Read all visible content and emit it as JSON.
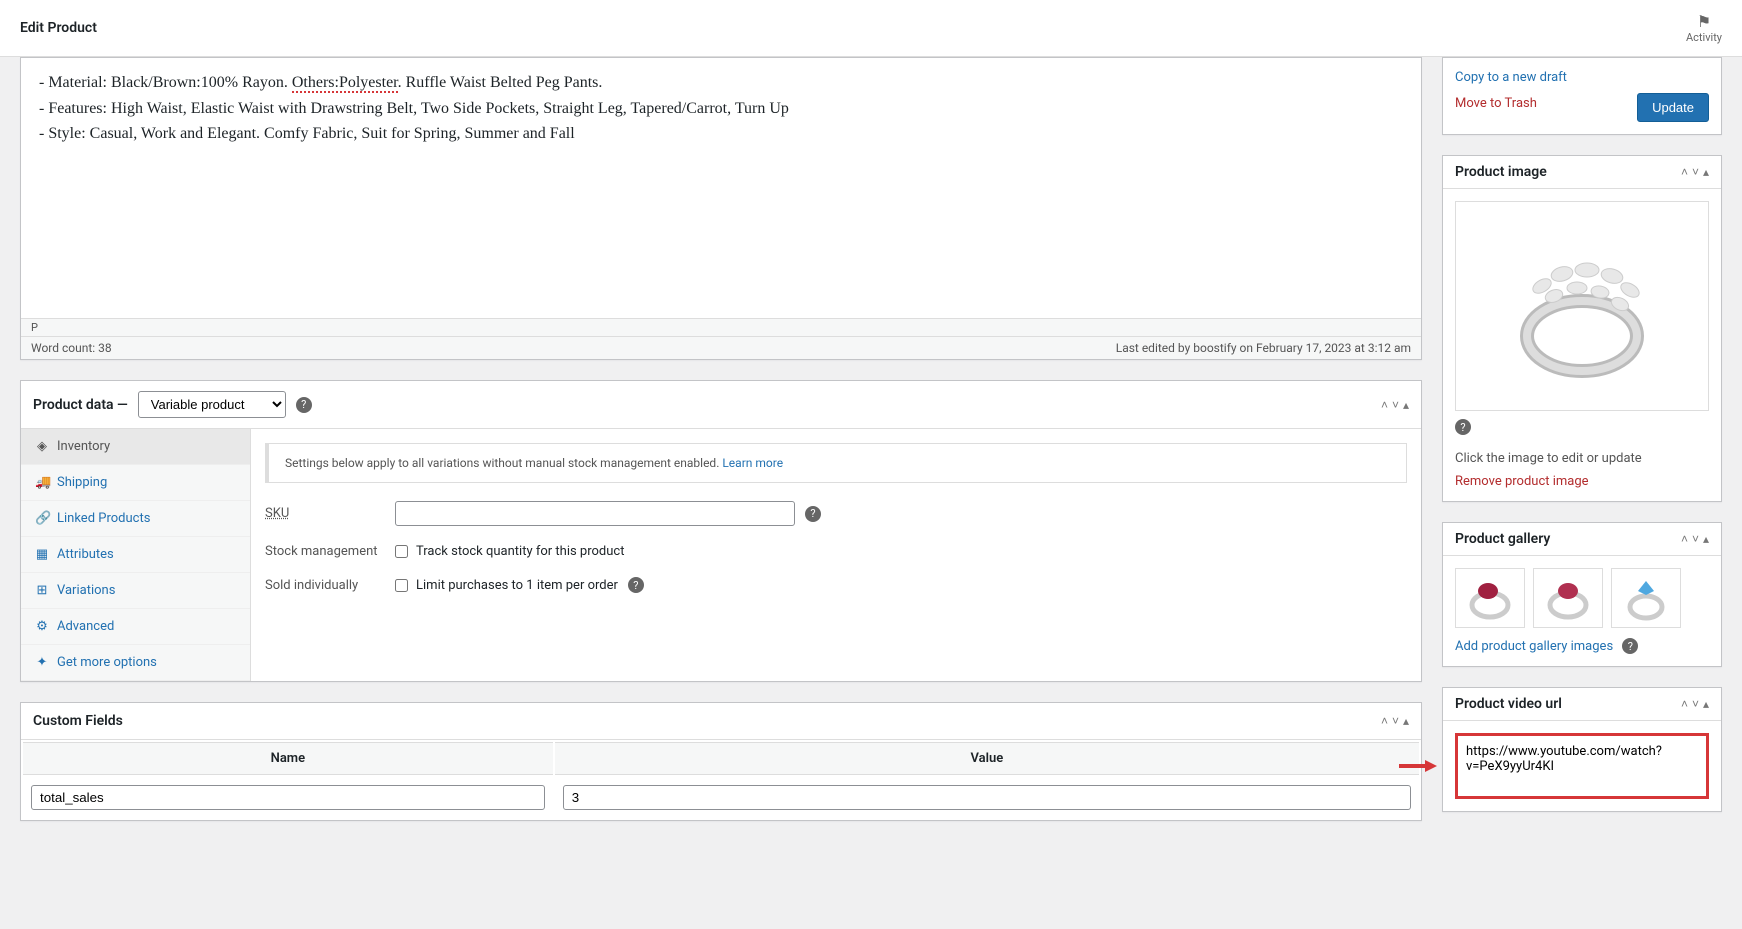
{
  "header": {
    "title": "Edit Product",
    "activity_label": "Activity"
  },
  "editor": {
    "line1_prefix": "- Material: Black/Brown:100% Rayon. ",
    "line1_underlined": "Others:Polyester",
    "line1_suffix": ". Ruffle Waist Belted Peg Pants.",
    "line2": "- Features: High Waist, Elastic Waist with Drawstring Belt, Two Side Pockets, Straight Leg, Tapered/Carrot, Turn Up",
    "line3": "- Style: Casual, Work and Elegant. Comfy Fabric, Suit for Spring, Summer and Fall",
    "path": "p",
    "word_count": "Word count: 38",
    "last_edited": "Last edited by boostify on February 17, 2023 at 3:12 am"
  },
  "product_data": {
    "title": "Product data",
    "select_value": "Variable product",
    "tabs": {
      "inventory": "Inventory",
      "shipping": "Shipping",
      "linked": "Linked Products",
      "attributes": "Attributes",
      "variations": "Variations",
      "advanced": "Advanced",
      "more": "Get more options"
    },
    "notice": "Settings below apply to all variations without manual stock management enabled. ",
    "notice_link": "Learn more",
    "sku_label": "SKU",
    "stock_label": "Stock management",
    "stock_cb": "Track stock quantity for this product",
    "sold_label": "Sold individually",
    "sold_cb": "Limit purchases to 1 item per order"
  },
  "custom_fields": {
    "title": "Custom Fields",
    "name_header": "Name",
    "value_header": "Value",
    "row1_name": "total_sales",
    "row1_value": "3"
  },
  "publish": {
    "copy": "Copy to a new draft",
    "trash": "Move to Trash",
    "update": "Update"
  },
  "product_image": {
    "title": "Product image",
    "click_text": "Click the image to edit or update",
    "remove": "Remove product image"
  },
  "gallery": {
    "title": "Product gallery",
    "add_link": "Add product gallery images"
  },
  "video": {
    "title": "Product video url",
    "value": "https://www.youtube.com/watch?v=PeX9yyUr4KI"
  }
}
